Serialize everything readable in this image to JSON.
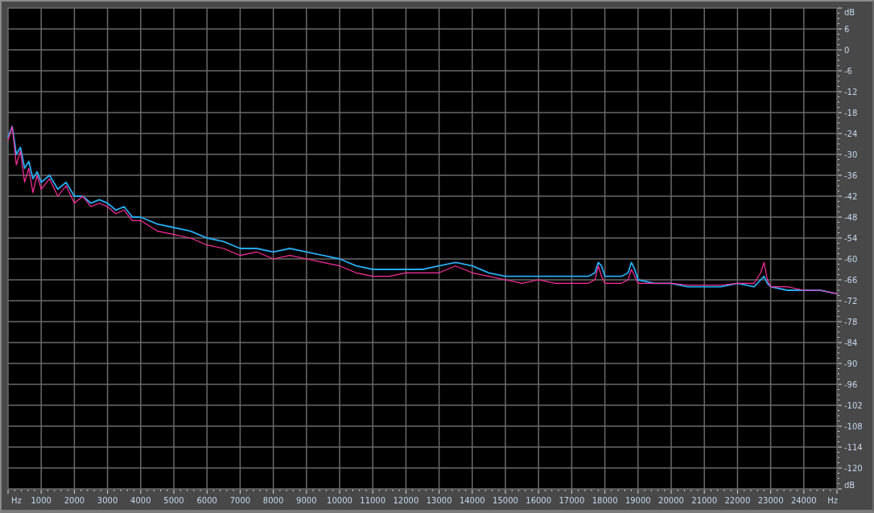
{
  "analyzer": {
    "x_unit_labels": [
      "Hz",
      "Hz"
    ],
    "y_unit_labels": [
      "dB",
      "dB"
    ],
    "chart_data": {
      "type": "line",
      "xlim": [
        0,
        25000
      ],
      "ylim": [
        -126,
        12
      ],
      "grid": true,
      "xticks": [
        1000,
        2000,
        3000,
        4000,
        5000,
        6000,
        7000,
        8000,
        9000,
        10000,
        11000,
        12000,
        13000,
        14000,
        15000,
        16000,
        17000,
        18000,
        19000,
        20000,
        21000,
        22000,
        23000,
        24000
      ],
      "yticks": [
        6,
        0,
        -6,
        -12,
        -18,
        -24,
        -30,
        -36,
        -42,
        -48,
        -54,
        -60,
        -66,
        -72,
        -78,
        -84,
        -90,
        -96,
        -102,
        -108,
        -114,
        -120
      ],
      "x": [
        0,
        125,
        250,
        375,
        500,
        625,
        750,
        875,
        1000,
        1250,
        1500,
        1750,
        2000,
        2250,
        2500,
        2750,
        3000,
        3250,
        3500,
        3750,
        4000,
        4500,
        5000,
        5500,
        6000,
        6500,
        7000,
        7500,
        8000,
        8500,
        9000,
        9500,
        10000,
        10500,
        11000,
        11500,
        12000,
        12500,
        13000,
        13500,
        14000,
        14500,
        15000,
        15500,
        16000,
        16500,
        17000,
        17500,
        17700,
        17800,
        17900,
        18000,
        18500,
        18700,
        18800,
        18900,
        19000,
        19500,
        20000,
        20500,
        21000,
        21500,
        22000,
        22500,
        22700,
        22800,
        22900,
        23000,
        23500,
        24000,
        24500,
        25000
      ],
      "series": [
        {
          "color": "#29aaf0",
          "values": [
            -25,
            -22,
            -30,
            -28,
            -34,
            -32,
            -37,
            -35,
            -38,
            -36,
            -40,
            -38,
            -42,
            -42,
            -44,
            -43,
            -44,
            -46,
            -45,
            -48,
            -48,
            -50,
            -51,
            -52,
            -54,
            -55,
            -57,
            -57,
            -58,
            -57,
            -58,
            -59,
            -60,
            -62,
            -63,
            -63,
            -63,
            -63,
            -62,
            -61,
            -62,
            -64,
            -65,
            -65,
            -65,
            -65,
            -65,
            -65,
            -64,
            -61,
            -62,
            -65,
            -65,
            -64,
            -61,
            -63,
            -66,
            -67,
            -67,
            -68,
            -68,
            -68,
            -67,
            -68,
            -66,
            -65,
            -67,
            -68,
            -69,
            -69,
            -69,
            -70
          ]
        },
        {
          "color": "#ff2f9e",
          "values": [
            -26,
            -22,
            -33,
            -29,
            -38,
            -34,
            -41,
            -36,
            -40,
            -37,
            -42,
            -39,
            -44,
            -42,
            -45,
            -44,
            -45,
            -47,
            -46,
            -49,
            -49,
            -52,
            -53,
            -54,
            -56,
            -57,
            -59,
            -58,
            -60,
            -59,
            -60,
            -61,
            -62,
            -64,
            -65,
            -65,
            -64,
            -64,
            -64,
            -62,
            -64,
            -65,
            -66,
            -67,
            -66,
            -67,
            -67,
            -67,
            -66,
            -62,
            -65,
            -67,
            -67,
            -66,
            -63,
            -65,
            -67,
            -67,
            -67,
            -67.5,
            -67.5,
            -67.5,
            -67,
            -67,
            -64,
            -61,
            -66,
            -68,
            -68,
            -69,
            -69,
            -70
          ]
        }
      ]
    }
  }
}
